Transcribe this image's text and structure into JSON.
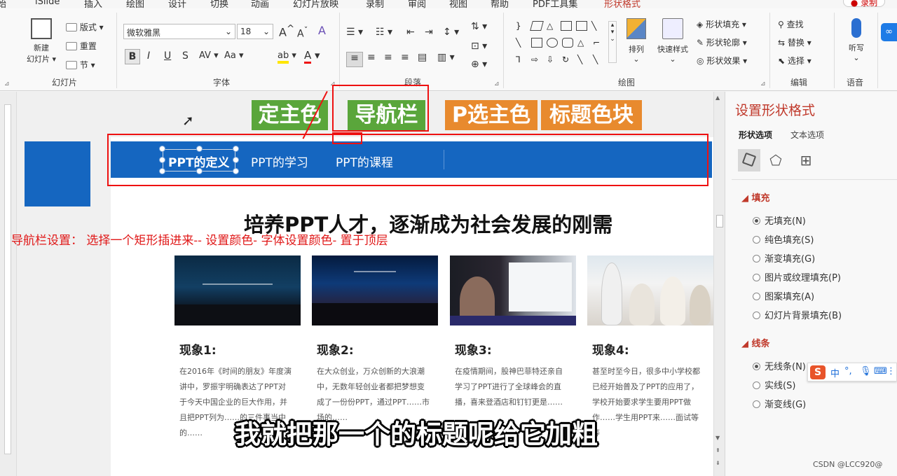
{
  "ribbon": {
    "tabs": [
      "插入",
      "绘图",
      "设计",
      "切换",
      "动画",
      "幻灯片放映",
      "录制",
      "审阅",
      "视图",
      "帮助",
      "PDF工具集",
      "形状格式"
    ],
    "partial_tabs": [
      "iSlide"
    ],
    "record_button": "录制",
    "slides_group": {
      "label": "幻灯片",
      "new_slide": "新建",
      "new_slide2": "幻灯片",
      "layout": "版式",
      "reset": "重置",
      "section": "节"
    },
    "font_group": {
      "label": "字体",
      "font_name": "微软雅黑",
      "font_size": "18",
      "grow": "A",
      "shrink": "A",
      "clear_format": "A",
      "bold": "B",
      "italic": "I",
      "underline": "U",
      "strike": "S",
      "spacing": "AV",
      "case": "Aa",
      "highlight": "ab",
      "font_color": "A"
    },
    "paragraph_group": {
      "label": "段落"
    },
    "drawing_group": {
      "label": "绘图",
      "arrange": "排列",
      "quick_styles": "快速样式",
      "fill": "形状填充",
      "outline": "形状轮廓",
      "effects": "形状效果"
    },
    "editing_group": {
      "label": "编辑",
      "find": "查找",
      "replace": "替换",
      "select": "选择"
    },
    "voice_group": {
      "label": "语音",
      "dictate": "听写"
    }
  },
  "slide": {
    "tags": {
      "theme_color": "定主色",
      "navbar": "导航栏",
      "p_theme": "P选主色",
      "title_block": "标题色块"
    },
    "nav_items": [
      "PPT的定义",
      "PPT的学习",
      "PPT的课程"
    ],
    "headline": "培养PPT人才，逐渐成为社会发展的刚需",
    "annotation": "导航栏设置： 选择一个矩形插进来-- 设置颜色- 字体设置颜色- 置于顶层",
    "phenomena": [
      {
        "title": "现象1:",
        "text": "在2016年《时间的朋友》年度演讲中，罗振宇明确表达了PPT对于今天中国企业的巨大作用，并且把PPT列为……的三件事当中的……"
      },
      {
        "title": "现象2:",
        "text": "在大众创业，万众创新的大浪潮中，无数年轻创业者都把梦想变成了一份份PPT，通过PPT……市场的……"
      },
      {
        "title": "现象3:",
        "text": "在疫情期间，股神巴菲特还亲自学习了PPT进行了全球峰会的直播，喜来登酒店和钉钉更是……"
      },
      {
        "title": "现象4:",
        "text": "甚至时至今日，很多中小学校都已经开始普及了PPT的应用了，学校开始要求学生要用PPT做作……学生用PPT来……面试等等"
      }
    ],
    "caption": "我就把那一个的标题呢给它加粗"
  },
  "format_pane": {
    "title": "设置形状格式",
    "tabs": [
      "形状选项",
      "文本选项"
    ],
    "fill_header": "填充",
    "fill_options": [
      {
        "label": "无填充(N)",
        "selected": true
      },
      {
        "label": "纯色填充(S)",
        "selected": false
      },
      {
        "label": "渐变填充(G)",
        "selected": false
      },
      {
        "label": "图片或纹理填充(P)",
        "selected": false
      },
      {
        "label": "图案填充(A)",
        "selected": false
      },
      {
        "label": "幻灯片背景填充(B)",
        "selected": false
      }
    ],
    "line_header": "线条",
    "line_options": [
      {
        "label": "无线条(N)",
        "selected": true
      },
      {
        "label": "实线(S)",
        "selected": false
      },
      {
        "label": "渐变线(G)",
        "selected": false
      }
    ]
  },
  "ime": {
    "logo": "S",
    "lang": "中",
    "punct": "°,"
  },
  "watermark": "CSDN @LCC920@",
  "colors": {
    "nav_blue": "#1566c0",
    "tag_green": "#5aa63b",
    "tag_orange": "#e88a2e",
    "annotation_red": "#e01818",
    "pane_accent": "#c0392b"
  }
}
